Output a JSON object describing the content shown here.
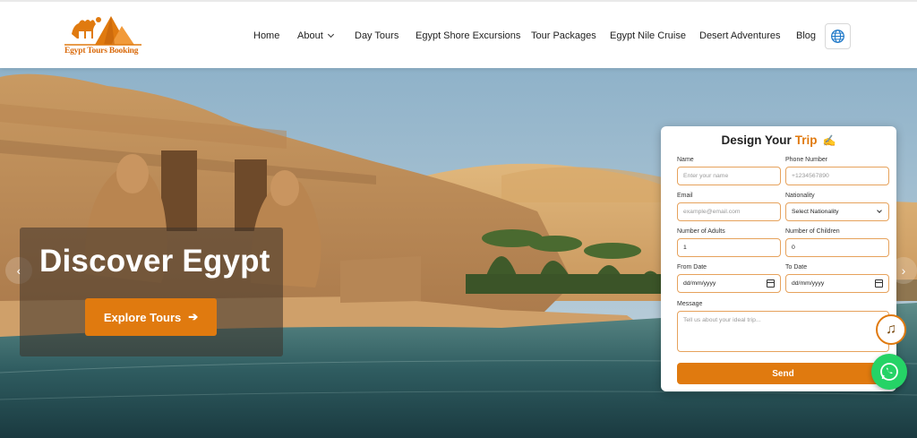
{
  "brand": {
    "name": "Egypt Tours Booking",
    "accent": "#e07a0f"
  },
  "nav": {
    "items": [
      {
        "label": "Home"
      },
      {
        "label": "About",
        "has_dropdown": true
      },
      {
        "label": "Day Tours"
      },
      {
        "label": "Egypt Shore Excursions"
      },
      {
        "label": "Tour Packages"
      },
      {
        "label": "Egypt Nile Cruise"
      },
      {
        "label": "Desert Adventures"
      },
      {
        "label": "Blog"
      }
    ],
    "language_icon": "globe-icon"
  },
  "hero": {
    "title": "Discover Egypt",
    "cta_label": "Explore Tours",
    "prev_icon": "chevron-left-icon",
    "next_icon": "chevron-right-icon"
  },
  "form": {
    "title_part1": "Design Your",
    "title_part2": "Trip",
    "title_icon": "✍",
    "name_label": "Name",
    "name_placeholder": "Enter your name",
    "phone_label": "Phone Number",
    "phone_placeholder": "+1234567890",
    "email_label": "Email",
    "email_placeholder": "example@email.com",
    "nationality_label": "Nationality",
    "nationality_value": "Select Nationality",
    "adults_label": "Number of Adults",
    "adults_value": "1",
    "children_label": "Number of Children",
    "children_value": "0",
    "from_label": "From Date",
    "from_value": "dd/mm/yyyy",
    "to_label": "To Date",
    "to_value": "dd/mm/yyyy",
    "message_label": "Message",
    "message_placeholder": "Tell us about your ideal trip...",
    "send_label": "Send"
  },
  "floating": {
    "music_icon": "♫",
    "whatsapp_icon": "whatsapp-icon"
  }
}
